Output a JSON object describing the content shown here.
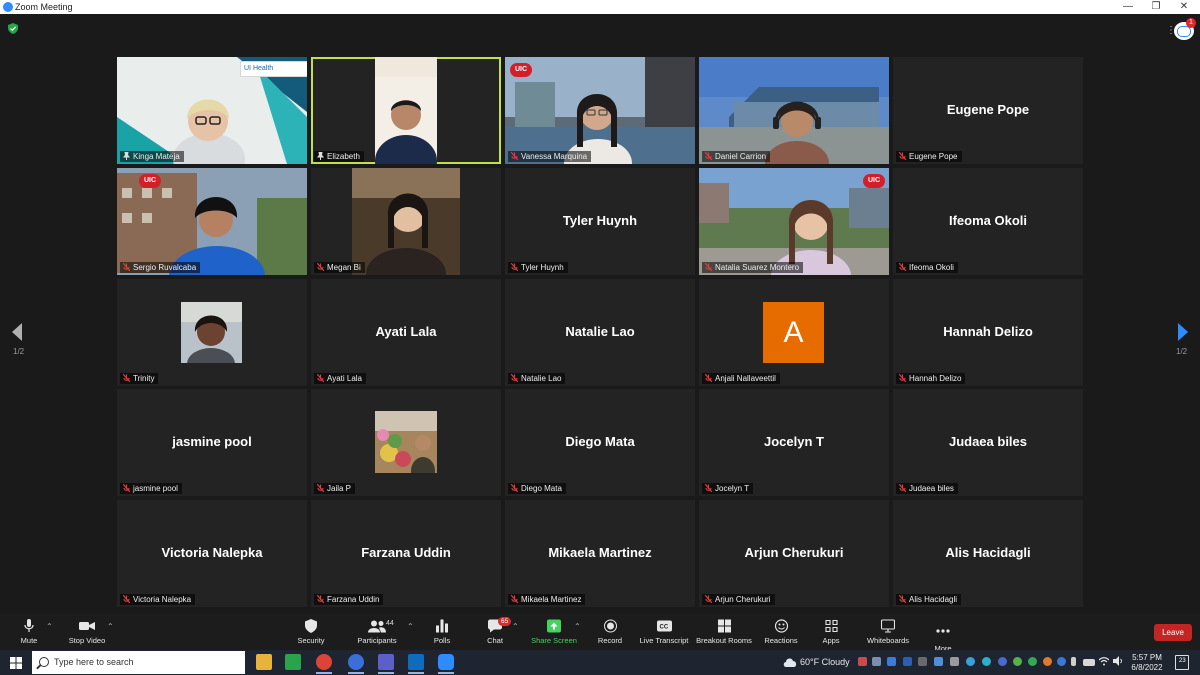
{
  "window": {
    "title": "Zoom Meeting"
  },
  "colors": {
    "meeting_bg": "#1a1a1a",
    "tile_bg": "#232323",
    "active_speaker_border": "#c2e04a",
    "share_screen_green": "#46d160",
    "leave_red": "#c32424",
    "avatar_orange": "#e66c00",
    "uic_red": "#d21f2b"
  },
  "participants": [
    {
      "name": "Kinga Mateja",
      "video": true,
      "pinned": true
    },
    {
      "name": "Elizabeth",
      "video": true,
      "pinned": true,
      "active_speaker": true
    },
    {
      "name": "Vanessa Marquina",
      "video": true,
      "muted": true,
      "badge": "UIC"
    },
    {
      "name": "Daniel Carrion",
      "video": true,
      "muted": true
    },
    {
      "name": "Eugene Pope",
      "video": false,
      "muted": true
    },
    {
      "name": "Sergio Ruvalcaba",
      "video": true,
      "muted": true,
      "badge": "UIC"
    },
    {
      "name": "Megan Bi",
      "video": true,
      "muted": true
    },
    {
      "name": "Tyler Huynh",
      "video": false,
      "muted": true
    },
    {
      "name": "Natalia Suarez Montero",
      "video": true,
      "muted": true,
      "badge": "UIC"
    },
    {
      "name": "Ifeoma Okoli",
      "video": false,
      "muted": true
    },
    {
      "name": "Trinity",
      "video": false,
      "photo": true,
      "muted": true
    },
    {
      "name": "Ayati Lala",
      "video": false,
      "muted": true
    },
    {
      "name": "Natalie Lao",
      "video": false,
      "muted": true
    },
    {
      "name": "Anjali Nallaveettil",
      "video": false,
      "avatar_letter": "A",
      "muted": true
    },
    {
      "name": "Hannah Delizo",
      "video": false,
      "muted": true
    },
    {
      "name": "jasmine pool",
      "video": false,
      "muted": true
    },
    {
      "name": "Jaila P",
      "video": false,
      "photo": true,
      "muted": true
    },
    {
      "name": "Diego Mata",
      "video": false,
      "muted": true
    },
    {
      "name": "Jocelyn T",
      "video": false,
      "muted": true
    },
    {
      "name": "Judaea biles",
      "video": false,
      "muted": true
    },
    {
      "name": "Victoria Nalepka",
      "video": false,
      "muted": true
    },
    {
      "name": "Farzana Uddin",
      "video": false,
      "muted": true
    },
    {
      "name": "Mikaela Martinez",
      "video": false,
      "muted": true
    },
    {
      "name": "Arjun Cherukuri",
      "video": false,
      "muted": true
    },
    {
      "name": "Alis Hacidagli",
      "video": false,
      "muted": true
    }
  ],
  "gallery": {
    "page_left": "1/2",
    "page_right": "1/2",
    "badge_text": "UIC",
    "ui_health_logo": "UI Health",
    "avatar_letter": "A"
  },
  "chat_bubble_count": "1",
  "toolbar": {
    "mute": "Mute",
    "stop_video": "Stop Video",
    "security": "Security",
    "participants": "Participants",
    "participants_count": "44",
    "polls": "Polls",
    "chat": "Chat",
    "chat_badge": "65",
    "share_screen": "Share Screen",
    "record": "Record",
    "live_transcript": "Live Transcript",
    "breakout_rooms": "Breakout Rooms",
    "reactions": "Reactions",
    "apps": "Apps",
    "whiteboards": "Whiteboards",
    "more": "More",
    "leave": "Leave"
  },
  "taskbar": {
    "search_placeholder": "Type here to search",
    "weather": "60°F  Cloudy",
    "time": "5:57 PM",
    "date": "6/8/2022",
    "notification_count": "23"
  }
}
